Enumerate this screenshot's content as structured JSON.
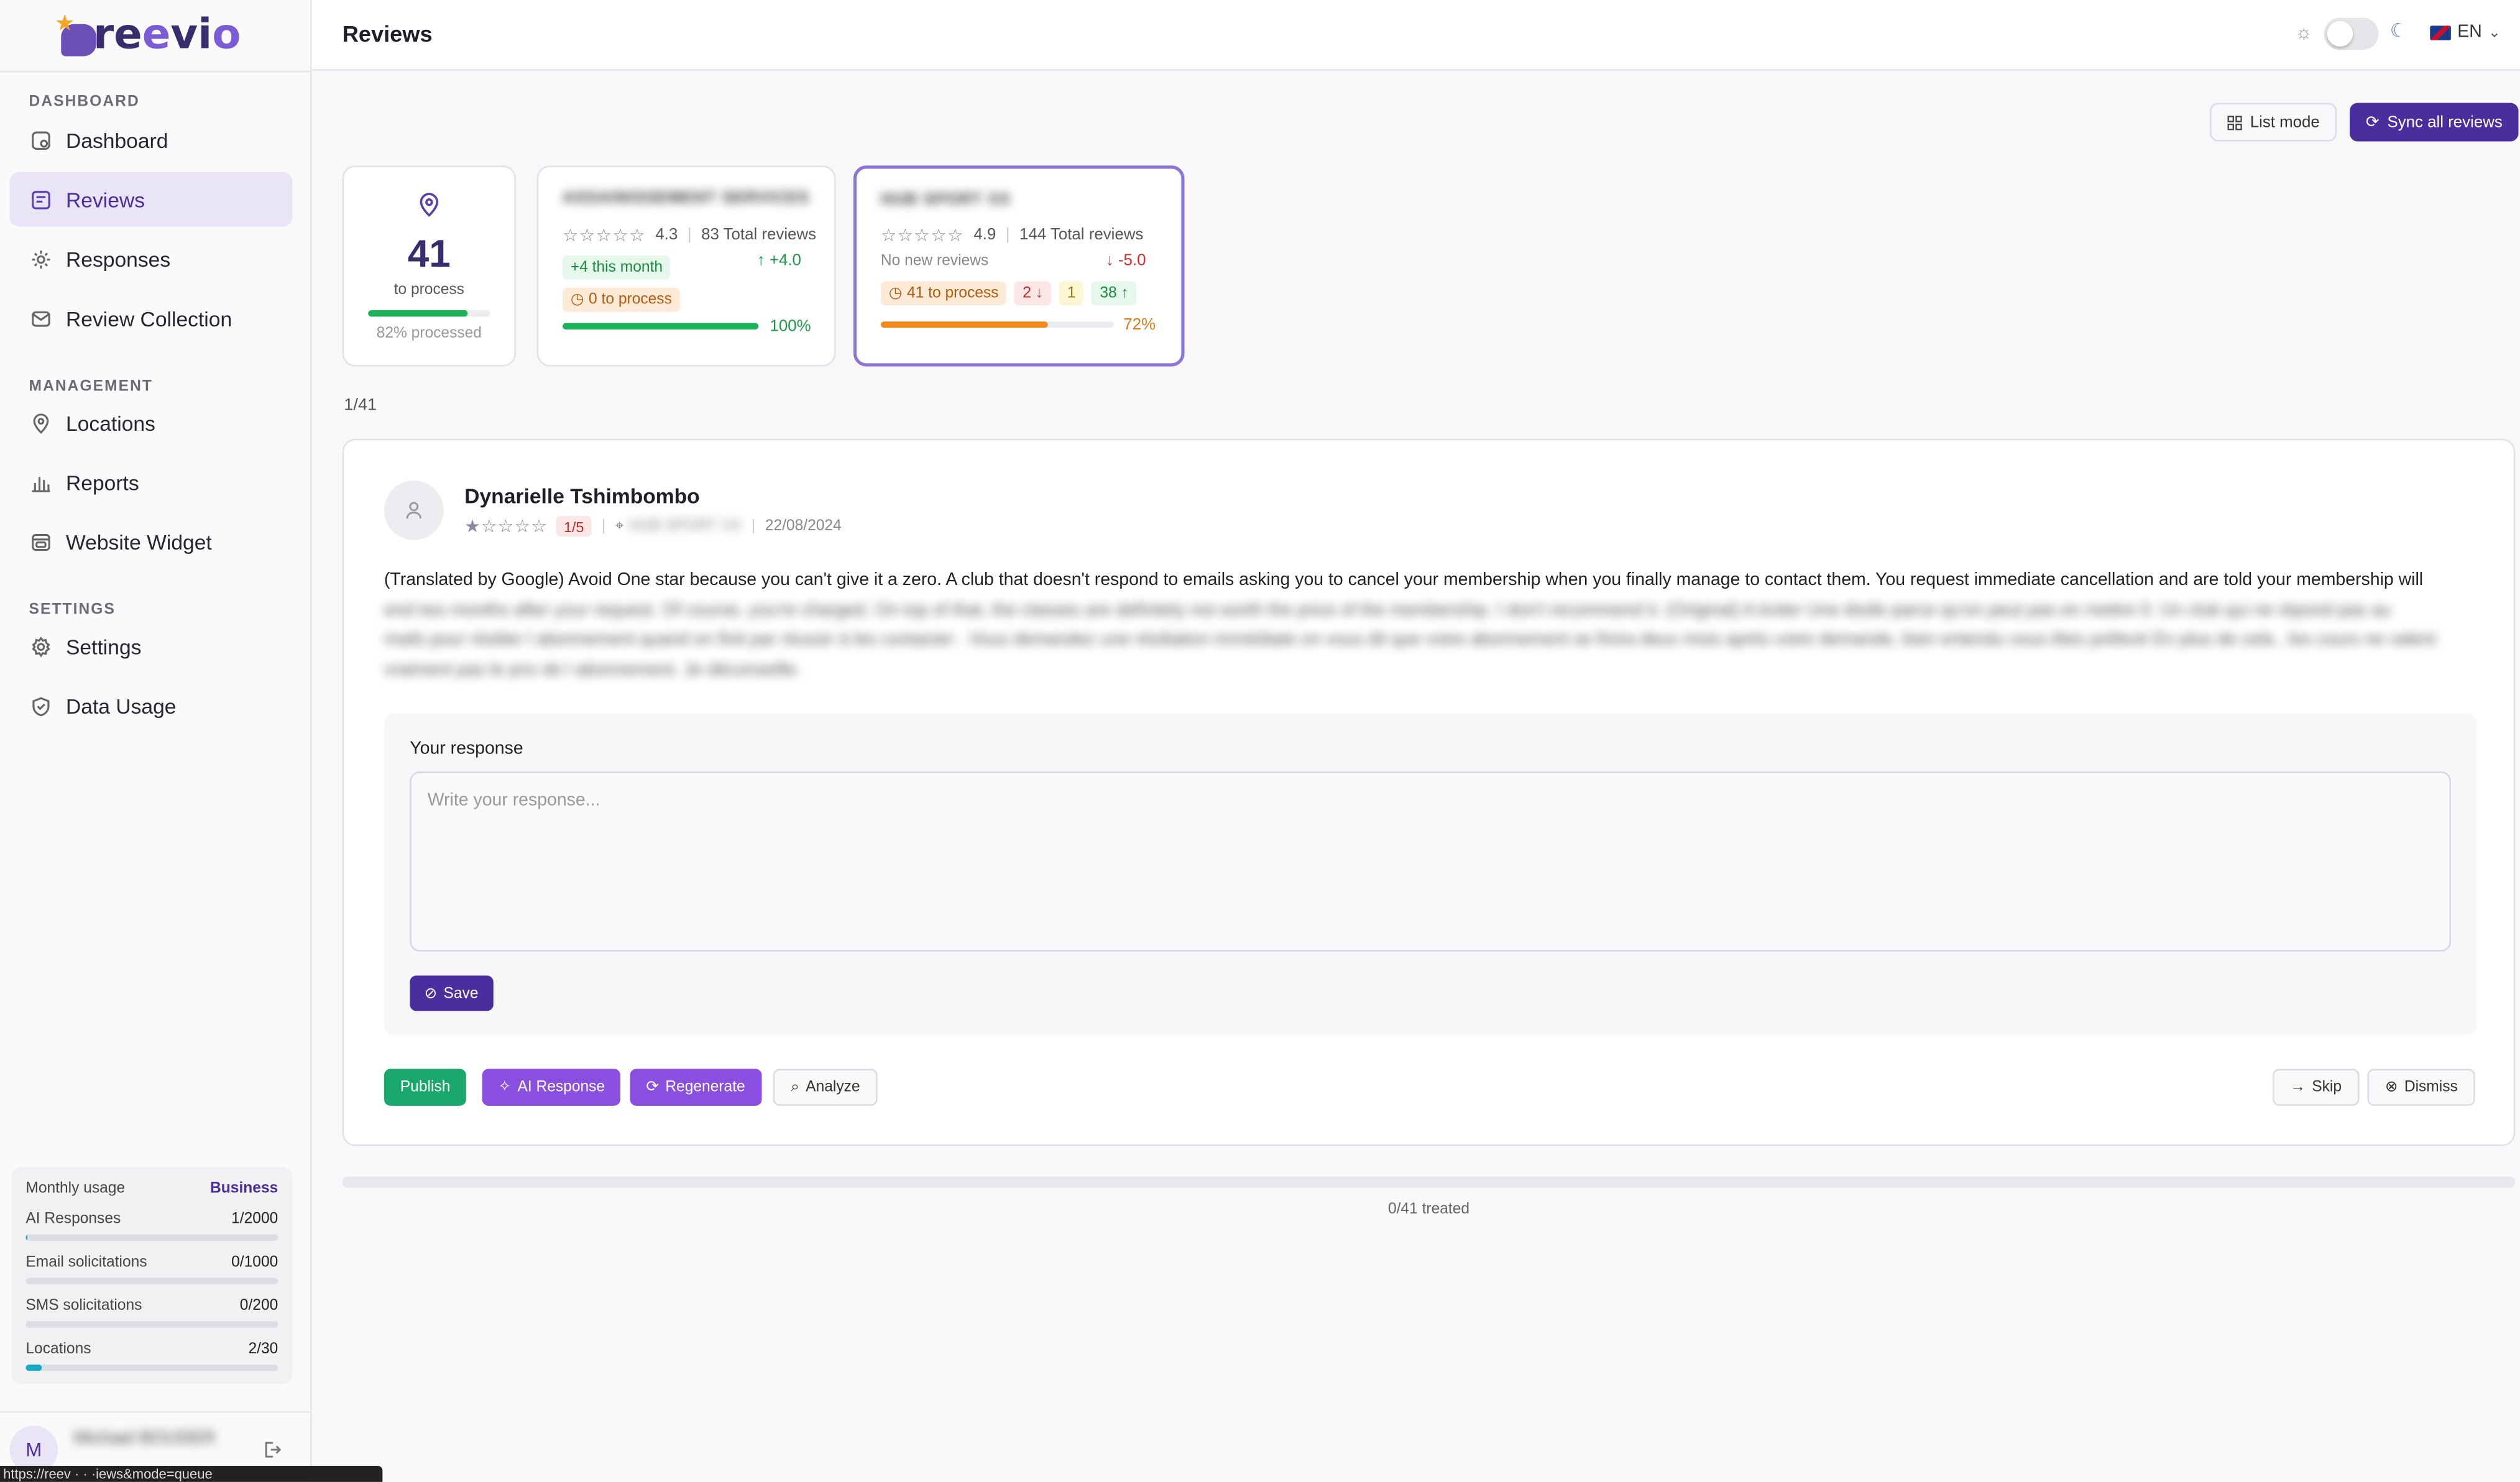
{
  "app": {
    "name_prefix": "re",
    "name_o1": "e",
    "name_mid": "vi",
    "name_o2": "o"
  },
  "sidebar": {
    "sections": {
      "dashboard": "DASHBOARD",
      "management": "MANAGEMENT",
      "settings": "SETTINGS"
    },
    "items": [
      {
        "label": "Dashboard",
        "icon": "dashboard-icon"
      },
      {
        "label": "Reviews",
        "icon": "reviews-icon",
        "active": true
      },
      {
        "label": "Responses",
        "icon": "responses-icon"
      },
      {
        "label": "Review Collection",
        "icon": "mail-icon"
      },
      {
        "label": "Locations",
        "icon": "location-pin-icon"
      },
      {
        "label": "Reports",
        "icon": "bar-chart-icon"
      },
      {
        "label": "Website Widget",
        "icon": "widget-icon"
      },
      {
        "label": "Settings",
        "icon": "gear-icon"
      },
      {
        "label": "Data Usage",
        "icon": "shield-icon"
      }
    ],
    "usage": {
      "title": "Monthly usage",
      "plan": "Business",
      "rows": [
        {
          "label": "AI Responses",
          "value": "1/2000",
          "fraction": 0.0005
        },
        {
          "label": "Email solicitations",
          "value": "0/1000",
          "fraction": 0
        },
        {
          "label": "SMS solicitations",
          "value": "0/200",
          "fraction": 0
        },
        {
          "label": "Locations",
          "value": "2/30",
          "fraction": 0.0667
        }
      ]
    },
    "user": {
      "initial": "M",
      "name": "Michael BOUDER"
    },
    "status_url": "https://reev       ·       ·      ·iews&mode=queue"
  },
  "topbar": {
    "title": "Reviews",
    "language": "EN"
  },
  "toolbar": {
    "list_mode": "List mode",
    "sync_all": "Sync all reviews"
  },
  "summary": {
    "count": "41",
    "count_label": "to process",
    "processed": "82% processed",
    "processed_fraction": 0.82
  },
  "locations": [
    {
      "name": "ASSAINISSEMENT SERVICES",
      "rating": "4.3",
      "total": "83 Total reviews",
      "this_month": "+4 this month",
      "trend": "+4.0",
      "to_process": "0 to process",
      "progress_pct": "100%",
      "progress_fraction": 1.0
    },
    {
      "name": "HUB SPORT XX",
      "rating": "4.9",
      "total": "144 Total reviews",
      "this_month": "No new reviews",
      "trend": "-5.0",
      "to_process": "41 to process",
      "neg": "2",
      "neutral": "1",
      "pos": "38",
      "progress_pct": "72%",
      "progress_fraction": 0.72
    }
  ],
  "queue": {
    "counter": "1/41",
    "treated": "0/41 treated"
  },
  "review": {
    "author": "Dynarielle Tshimbombo",
    "score": "1/5",
    "location": "HUB SPORT XX",
    "date": "22/08/2024",
    "text_visible": "(Translated by Google) Avoid One star because you can't give it a zero. A club that doesn't respond to emails asking you to cancel your membership when you finally manage to contact them. You request immediate cancellation and are told your membership will",
    "text_blurred_1": "end two months after your request. Of course, you're charged. On top of that, the classes are definitely not worth the price of the membership. I don't recommend it. (Original) A éviter Une étoile parce qu'on peut pas en mettre 0. Un club qui ne répond pas au",
    "text_blurred_2": "mails pour résilier l abonnement quand on finit par réussir à les contacter . Vous demandez une résiliation immédiate on vous dit que votre abonnement se finira deux mois après votre demande, bien entendu vous êtes prélevé En plus de cela , les cours ne valent",
    "text_blurred_3": "vraiment pas le prix de l abonnement. Je déconseille."
  },
  "response": {
    "label": "Your response",
    "placeholder": "Write your response...",
    "value": "",
    "save": "Save"
  },
  "actions": {
    "publish": "Publish",
    "ai_response": "AI Response",
    "regenerate": "Regenerate",
    "analyze": "Analyze",
    "skip": "Skip",
    "dismiss": "Dismiss"
  },
  "colors": {
    "brand": "#4b2e9e",
    "accent": "#8a4fe0",
    "success": "#1aa76b",
    "warning": "#f28a1e",
    "usage_bar": "#18a9c7"
  }
}
